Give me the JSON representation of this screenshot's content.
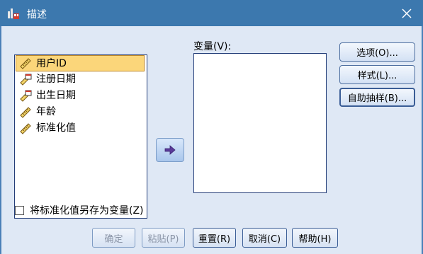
{
  "window": {
    "title": "描述",
    "close_icon": "close-icon"
  },
  "source_list": {
    "items": [
      {
        "label": "用户ID",
        "icon": "scale-ruler-icon",
        "selected": true
      },
      {
        "label": "注册日期",
        "icon": "scale-date-icon",
        "selected": false
      },
      {
        "label": "出生日期",
        "icon": "scale-date-icon",
        "selected": false
      },
      {
        "label": "年龄",
        "icon": "scale-ruler-icon",
        "selected": false
      },
      {
        "label": "标准化值",
        "icon": "scale-ruler-icon",
        "selected": false
      }
    ]
  },
  "move_button": {
    "icon": "arrow-right-icon"
  },
  "variables": {
    "label": "变量(V):"
  },
  "side_buttons": {
    "options": "选项(O)...",
    "style": "样式(L)...",
    "bootstrap": "自助抽样(B)..."
  },
  "save_standardized": {
    "label": "将标准化值另存为变量(Z)",
    "checked": false
  },
  "bottom_buttons": {
    "ok": "确定",
    "paste": "粘贴(P)",
    "reset": "重置(R)",
    "cancel": "取消(C)",
    "help": "帮助(H)"
  },
  "colors": {
    "titlebar": "#3c78ae",
    "dialog_bg": "#dfe8f5",
    "selection": "#fbd67a"
  }
}
